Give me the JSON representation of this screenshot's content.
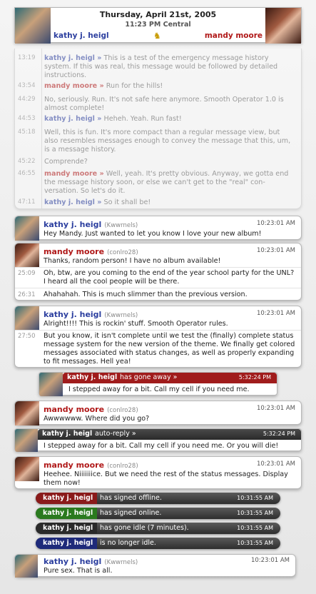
{
  "header": {
    "date": "Thursday, April 21st, 2005",
    "time": "11:23 PM Central",
    "left_name": "kathy j. heigl",
    "right_name": "mandy moore"
  },
  "history": [
    {
      "ts": "13:19",
      "name": "kathy j. heigl »",
      "who": "k",
      "text": "This is a test of the emergency message history system.  If this was real, this message would be followed by detailed instructions."
    },
    {
      "ts": "43:54",
      "name": "mandy moore »",
      "who": "m",
      "text": "Run for the hills!"
    },
    {
      "ts": "44:29",
      "name": "",
      "who": "",
      "text": "No, seriously.  Run.  It's not safe here anymore.  Smooth Operator 1.0 is almost complete!"
    },
    {
      "ts": "44:53",
      "name": "kathy j. heigl »",
      "who": "k",
      "text": "Heheh.  Yeah.  Run fast!"
    },
    {
      "ts": "45:18",
      "name": "",
      "who": "",
      "text": "Well, this is fun.  It's more compact than a regular message view, but also resembles messages enough to convey the message that this, um, is a message history."
    },
    {
      "ts": "45:22",
      "name": "",
      "who": "",
      "text": "Comprende?"
    },
    {
      "ts": "46:55",
      "name": "mandy moore »",
      "who": "m",
      "text": "Well, yeah.  It's pretty obvious.  Anyway, we gotta end the message history soon, or else we can't get to the \"real\" con-versation.  So let's do it."
    },
    {
      "ts": "47:11",
      "name": "kathy j. heigl »",
      "who": "k",
      "text": "So it shall be!"
    }
  ],
  "messages": {
    "m1": {
      "name": "kathy j. heigl",
      "nick": "(Kwwrnels)",
      "time": "10:23:01 AM",
      "lines": [
        "Hey Mandy.  Just wanted to let you know I love your new album!"
      ]
    },
    "m2": {
      "name": "mandy moore",
      "nick": "(conlro28)",
      "time": "10:23:01 AM",
      "lines": [
        "Thanks, random person!  I have no album available!",
        "Oh, btw, are you coming to the end of the year school party for the UNL? I heard all the cool people will be there.",
        "Ahahahah.  This is much slimmer than the previous version."
      ],
      "ts": [
        "",
        "25:09",
        "26:31"
      ]
    },
    "m3": {
      "name": "kathy j. heigl",
      "nick": "(Kwwrnels)",
      "time": "10:23:01 AM",
      "lines": [
        "Alright!!!!  This is rockin' stuff.  Smooth Operator rules.",
        "But you know, it isn't complete until we test the (finally) complete status message system for the new version of the theme.  We finally get colored messages associated with status changes, as well as properly expanding to fit messages.  Hell yea!"
      ],
      "ts": [
        "",
        "27:50"
      ]
    },
    "away": {
      "name": "kathy j. heigl",
      "label": "has gone away »",
      "time": "5:32:24 PM",
      "text": "I stepped away for a bit.  Call my cell if you need me."
    },
    "m4": {
      "name": "mandy moore",
      "nick": "(conlro28)",
      "time": "10:23:01 AM",
      "text": "Awwwwww.  Where did you go?"
    },
    "autoreply": {
      "name": "kathy j. heigl",
      "label": "auto-reply »",
      "time": "5:32:24 PM",
      "text": "I stepped away for a bit.  Call my cell if you need me.  Or you will die!"
    },
    "m5": {
      "name": "mandy moore",
      "nick": "(conlro28)",
      "time": "10:23:01 AM",
      "text": "Heehee.  Niiiiiiice.  But we need the rest of the status messages. Display them now!"
    },
    "m6": {
      "name": "kathy j. heigl",
      "nick": "(Kwwrnels)",
      "time": "10:23:01 AM",
      "text": "Pure sex.  That is all."
    }
  },
  "statuses": [
    {
      "name": "kathy j. heigl",
      "text": "has signed offline.",
      "time": "10:31:55 AM",
      "color": "#8a1a1a"
    },
    {
      "name": "kathy j. heigl",
      "text": "has signed online.",
      "time": "10:31:55 AM",
      "color": "#2a7a1e"
    },
    {
      "name": "kathy j. heigl",
      "text": "has gone idle (7 minutes).",
      "time": "10:31:55 AM",
      "color": "#2a2a2a"
    },
    {
      "name": "kathy j. heigl",
      "text": "is no longer idle.",
      "time": "10:31:55 AM",
      "color": "#1e2a7a"
    }
  ],
  "colors": {
    "kathy": "#2c3f9f",
    "mandy": "#b01818",
    "away": "#a01c1c"
  }
}
